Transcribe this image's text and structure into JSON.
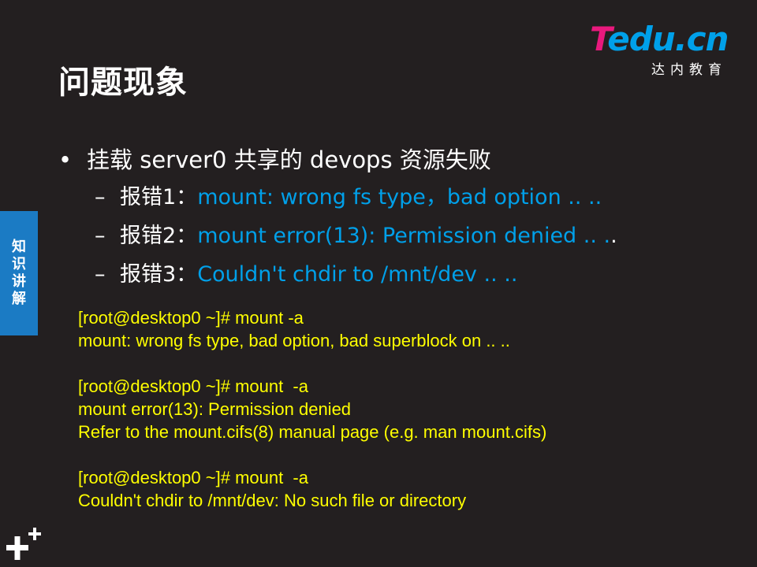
{
  "title": "问题现象",
  "logo": {
    "word_first": "T",
    "word_rest": "edu.cn",
    "subtitle": "达内教育"
  },
  "side_tab": {
    "label": "知识讲解"
  },
  "bullet": {
    "text": "挂载 server0 共享的 devops 资源失败"
  },
  "errors": [
    {
      "label": "报错1：",
      "message": "mount: wrong fs type，bad option .. ..",
      "tail": ""
    },
    {
      "label": "报错2：",
      "message": "mount error(13): Permission denied .. .",
      "tail": "."
    },
    {
      "label": "报错3：",
      "message": "Couldn't chdir to /mnt/dev .. ..",
      "tail": ""
    }
  ],
  "terminal": {
    "block1": {
      "line1": "[root@desktop0 ~]# mount -a",
      "line2": "mount: wrong fs type, bad option, bad superblock on .. .."
    },
    "block2": {
      "line1": "[root@desktop0 ~]# mount  -a",
      "line2": "mount error(13): Permission denied",
      "line3": "Refer to the mount.cifs(8) manual page (e.g. man mount.cifs)"
    },
    "block3": {
      "line1": "[root@desktop0 ~]# mount  -a",
      "line2": "Couldn't chdir to /mnt/dev: No such file or directory"
    }
  },
  "colors": {
    "background": "#231f20",
    "accent_blue": "#00a0e9",
    "logo_pink": "#e8197d",
    "terminal_yellow": "#ffff00",
    "side_tab": "#1b7bc4"
  },
  "icons": {
    "corner": "plus-icon"
  }
}
